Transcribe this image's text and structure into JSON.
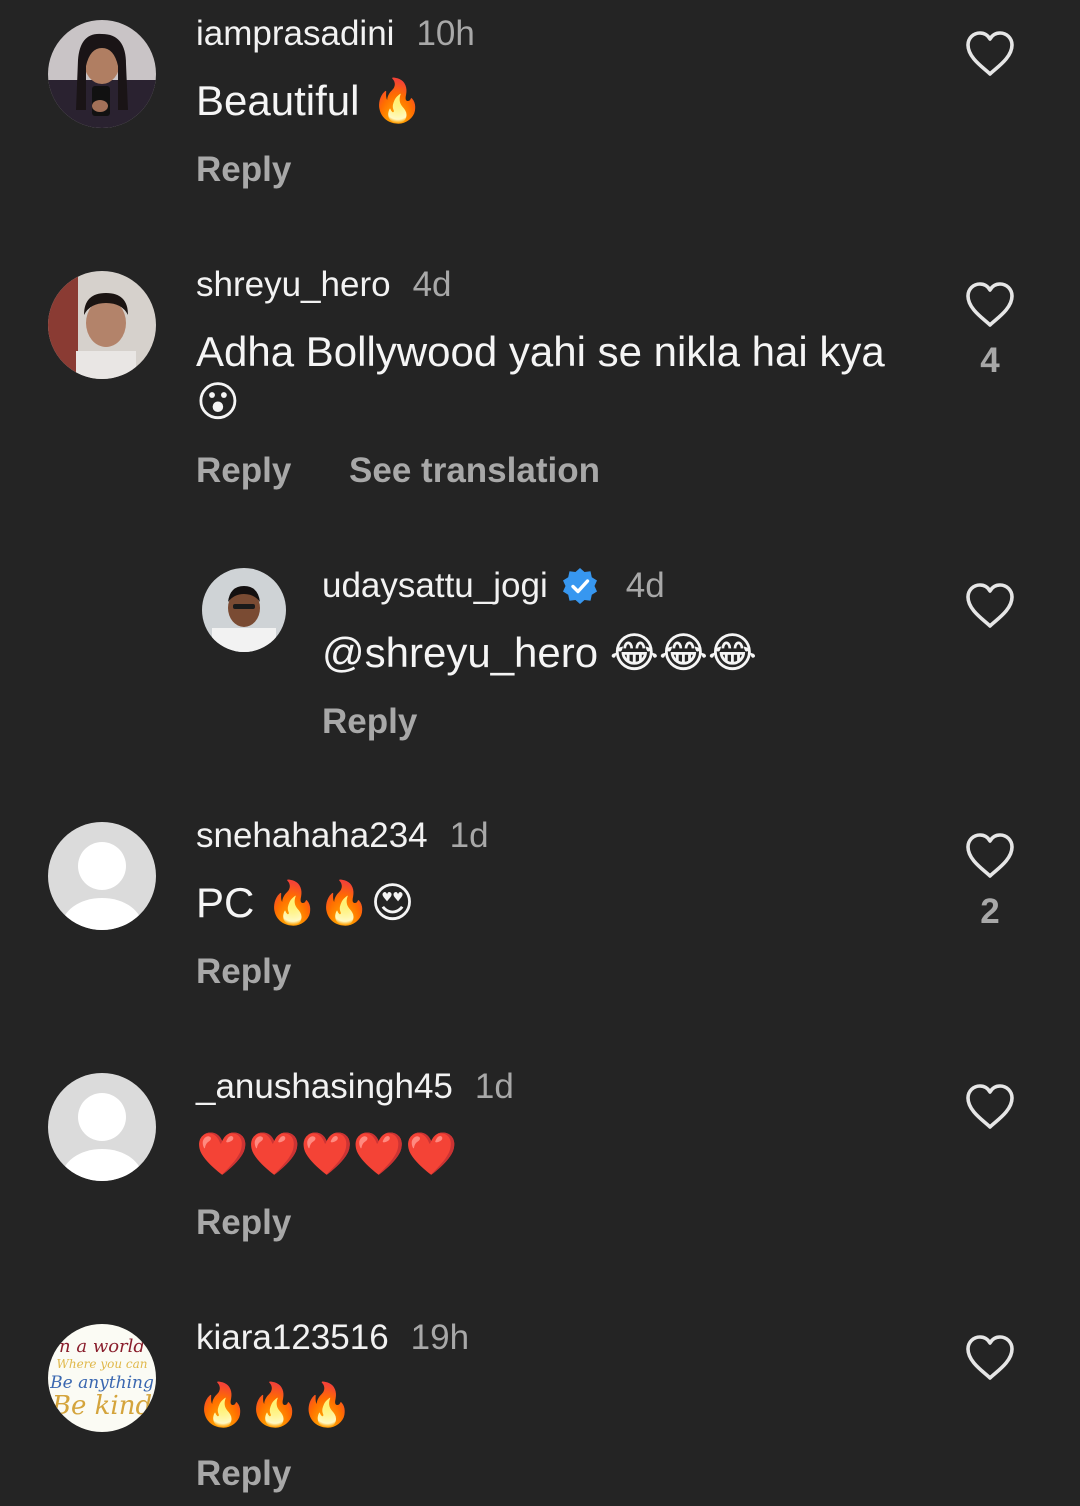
{
  "comments": [
    {
      "username": "iamprasadini",
      "time": "10h",
      "text": "Beautiful 🔥",
      "reply_label": "Reply",
      "like_count": ""
    },
    {
      "username": "shreyu_hero",
      "time": "4d",
      "text": "Adha Bollywood yahi se nikla hai kya 😮",
      "reply_label": "Reply",
      "translation_label": "See translation",
      "like_count": "4"
    },
    {
      "username": "udaysattu_jogi",
      "time": "4d",
      "text": "@shreyu_hero 😂😂😂",
      "reply_label": "Reply",
      "like_count": ""
    },
    {
      "username": "snehahaha234",
      "time": "1d",
      "text": "PC 🔥🔥😍",
      "reply_label": "Reply",
      "like_count": "2"
    },
    {
      "username": "_anushasingh45",
      "time": "1d",
      "text": "❤️❤️❤️❤️❤️",
      "reply_label": "Reply",
      "like_count": ""
    },
    {
      "username": "kiara123516",
      "time": "19h",
      "text": "🔥🔥🔥",
      "reply_label": "Reply",
      "like_count": ""
    }
  ],
  "avatar_badge": {
    "lines": [
      "n a world",
      "Where you can",
      "Be anything",
      "Be kind"
    ]
  },
  "colors": {
    "background": "#242424",
    "primary_text": "#f5f5f5",
    "secondary_text": "#a8a8a8",
    "verified_blue": "#3797f0",
    "placeholder_avatar": "#dbdbdb"
  }
}
